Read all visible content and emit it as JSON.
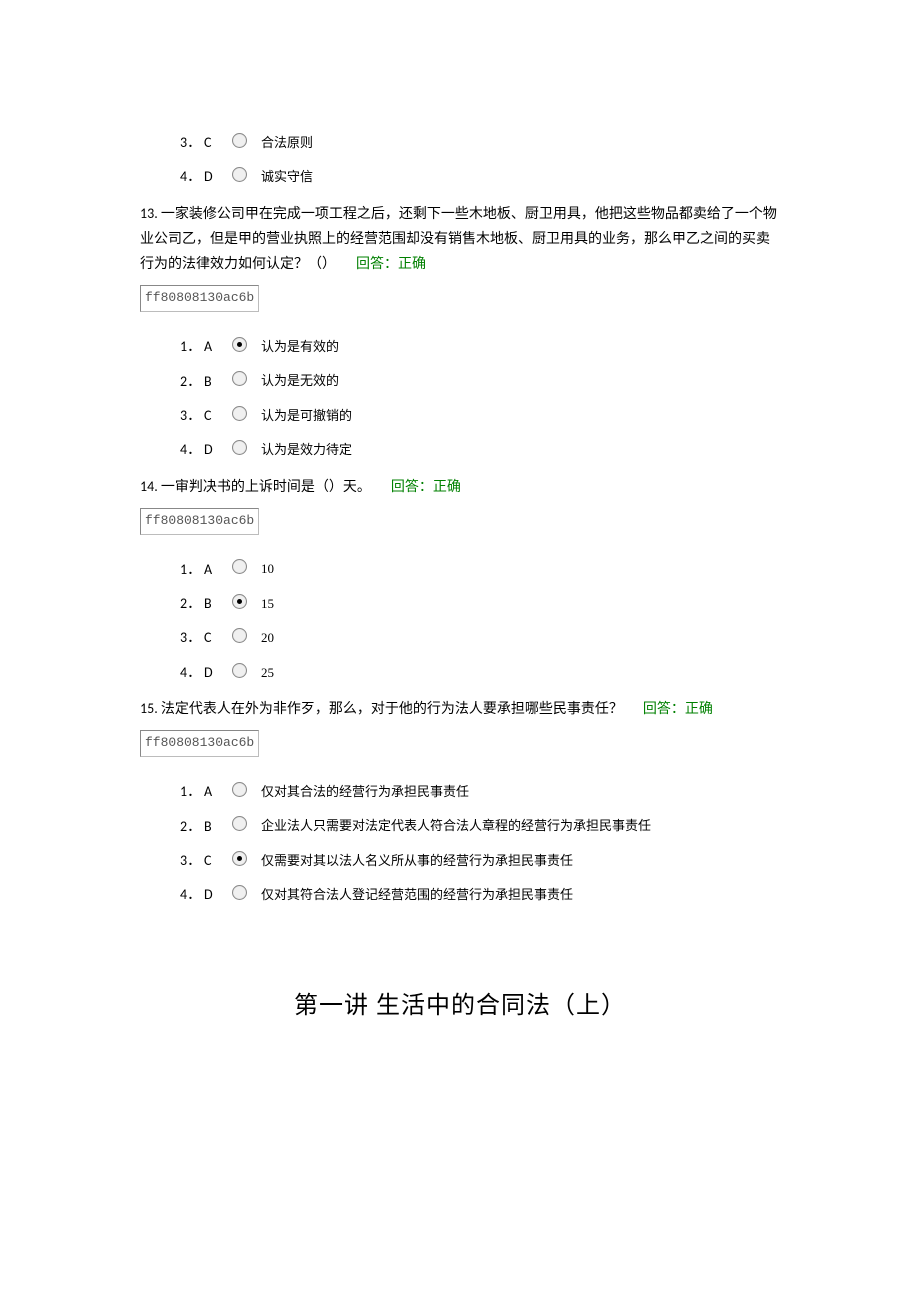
{
  "prev_options": [
    {
      "num": "3．",
      "letter": "C",
      "text": "合法原则",
      "selected": false
    },
    {
      "num": "4．",
      "letter": "D",
      "text": "诚实守信",
      "selected": false
    }
  ],
  "questions": [
    {
      "num": "13.",
      "text": "一家装修公司甲在完成一项工程之后，还剩下一些木地板、厨卫用具，他把这些物品都卖给了一个物业公司乙，但是甲的营业执照上的经营范围却没有销售木地板、厨卫用具的业务，那么甲乙之间的买卖行为的法律效力如何认定？（）",
      "status": "回答：正确",
      "code": "ff80808130ac6b",
      "options": [
        {
          "num": "1．",
          "letter": "A",
          "text": "认为是有效的",
          "selected": true
        },
        {
          "num": "2．",
          "letter": "B",
          "text": "认为是无效的",
          "selected": false
        },
        {
          "num": "3．",
          "letter": "C",
          "text": "认为是可撤销的",
          "selected": false
        },
        {
          "num": "4．",
          "letter": "D",
          "text": "认为是效力待定",
          "selected": false
        }
      ]
    },
    {
      "num": "14.",
      "text": "一审判决书的上诉时间是（）天。",
      "status": "回答：正确",
      "code": "ff80808130ac6b",
      "options": [
        {
          "num": "1．",
          "letter": "A",
          "text": "10",
          "selected": false
        },
        {
          "num": "2．",
          "letter": "B",
          "text": "15",
          "selected": true
        },
        {
          "num": "3．",
          "letter": "C",
          "text": "20",
          "selected": false
        },
        {
          "num": "4．",
          "letter": "D",
          "text": "25",
          "selected": false
        }
      ]
    },
    {
      "num": "15.",
      "text": "法定代表人在外为非作歹，那么，对于他的行为法人要承担哪些民事责任？",
      "status": "回答：正确",
      "code": "ff80808130ac6b",
      "options": [
        {
          "num": "1．",
          "letter": "A",
          "text": "仅对其合法的经营行为承担民事责任",
          "selected": false
        },
        {
          "num": "2．",
          "letter": "B",
          "text": "企业法人只需要对法定代表人符合法人章程的经营行为承担民事责任",
          "selected": false
        },
        {
          "num": "3．",
          "letter": "C",
          "text": "仅需要对其以法人名义所从事的经营行为承担民事责任",
          "selected": true
        },
        {
          "num": "4．",
          "letter": "D",
          "text": "仅对其符合法人登记经营范围的经营行为承担民事责任",
          "selected": false
        }
      ]
    }
  ],
  "section_title": "第一讲  生活中的合同法（上）"
}
